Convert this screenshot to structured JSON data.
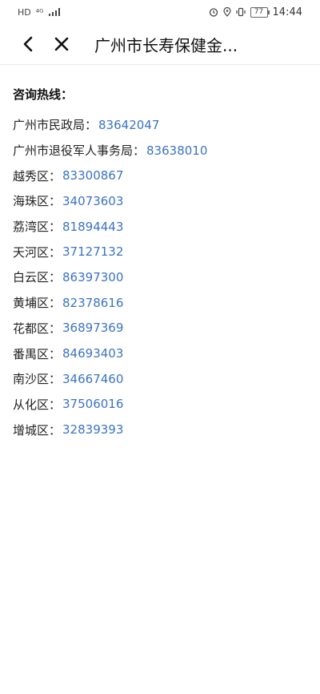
{
  "status": {
    "left_icons": [
      "hd-icon",
      "4g-icon",
      "signal-icon"
    ],
    "battery": "77",
    "time": "14:44"
  },
  "nav": {
    "title": "广州市长寿保健金..."
  },
  "content": {
    "heading": "咨询热线：",
    "hotlines": [
      {
        "label": "广州市民政局：",
        "phone": "83642047"
      },
      {
        "label": "广州市退役军人事务局：",
        "phone": "83638010"
      },
      {
        "label": "越秀区：",
        "phone": "83300867"
      },
      {
        "label": "海珠区：",
        "phone": "34073603"
      },
      {
        "label": "荔湾区：",
        "phone": "81894443"
      },
      {
        "label": "天河区：",
        "phone": "37127132"
      },
      {
        "label": "白云区：",
        "phone": "86397300"
      },
      {
        "label": "黄埔区：",
        "phone": "82378616"
      },
      {
        "label": "花都区：",
        "phone": "36897369"
      },
      {
        "label": "番禺区：",
        "phone": "84693403"
      },
      {
        "label": "南沙区：",
        "phone": "34667460"
      },
      {
        "label": "从化区：",
        "phone": "37506016"
      },
      {
        "label": "增城区：",
        "phone": "32839393"
      }
    ]
  },
  "colors": {
    "link": "#3b73c4"
  }
}
